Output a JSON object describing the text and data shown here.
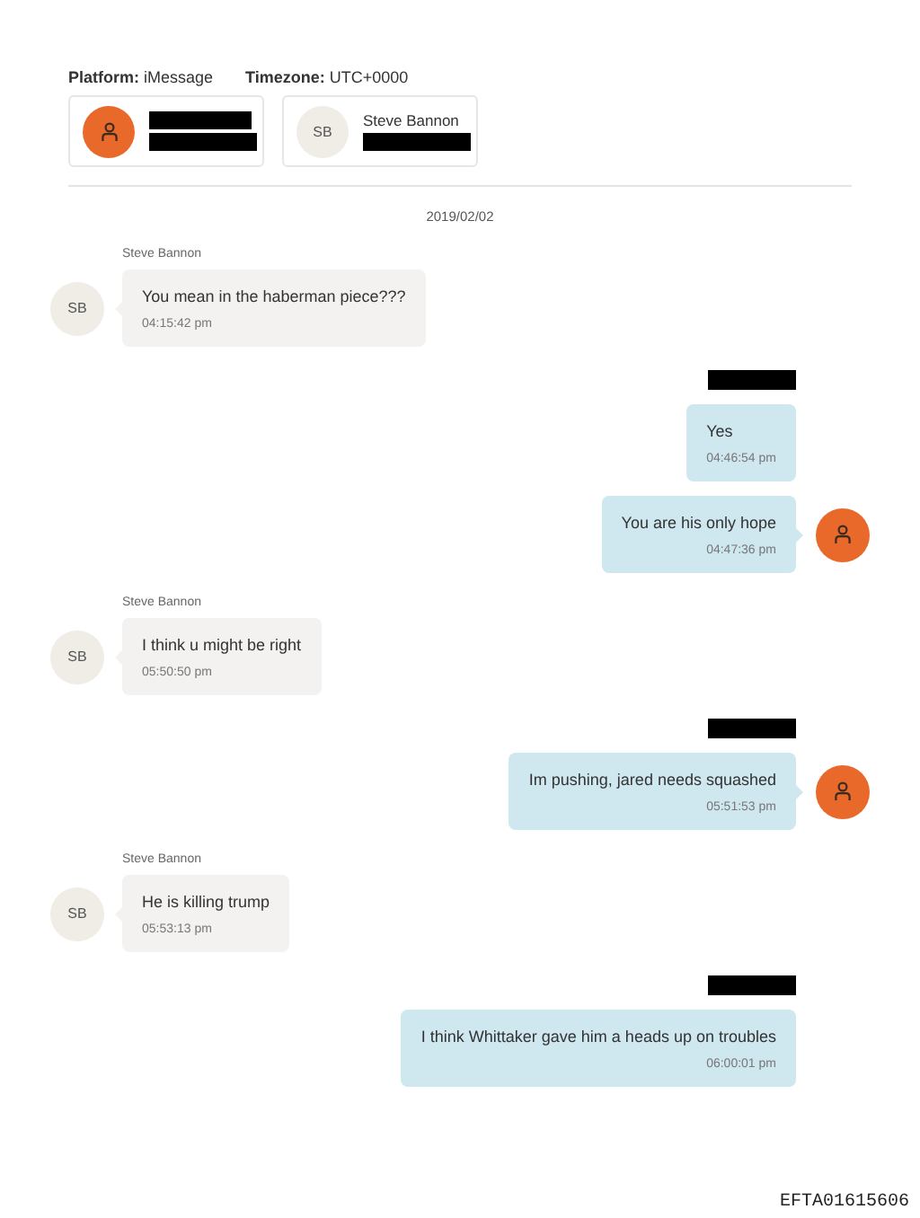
{
  "header": {
    "platform_label": "Platform:",
    "platform": "iMessage",
    "timezone_label": "Timezone:",
    "timezone": "UTC+0000"
  },
  "participants": [
    {
      "avatar": {
        "kind": "icon"
      },
      "name_redacted": true,
      "detail_redacted": true
    },
    {
      "avatar": {
        "kind": "initials",
        "initials": "SB"
      },
      "name": "Steve Bannon",
      "detail_redacted": true
    }
  ],
  "date": "2019/02/02",
  "groups": [
    {
      "kind": "in",
      "sender": "Steve Bannon",
      "messages": [
        {
          "text": "You mean in the haberman piece???",
          "time": "04:15:42 pm",
          "avatar": {
            "kind": "initials",
            "initials": "SB"
          }
        }
      ]
    },
    {
      "kind": "out",
      "sender_redacted": true,
      "messages": [
        {
          "text": "Yes",
          "time": "04:46:54 pm"
        },
        {
          "text": "You are his only hope",
          "time": "04:47:36 pm",
          "avatar": {
            "kind": "icon"
          }
        }
      ]
    },
    {
      "kind": "in",
      "sender": "Steve Bannon",
      "messages": [
        {
          "text": "I think u might be right",
          "time": "05:50:50 pm",
          "avatar": {
            "kind": "initials",
            "initials": "SB"
          }
        }
      ]
    },
    {
      "kind": "out",
      "sender_redacted": true,
      "messages": [
        {
          "text": "Im pushing, jared needs squashed",
          "time": "05:51:53 pm",
          "avatar": {
            "kind": "icon"
          }
        }
      ]
    },
    {
      "kind": "in",
      "sender": "Steve Bannon",
      "messages": [
        {
          "text": "He is killing trump",
          "time": "05:53:13 pm",
          "avatar": {
            "kind": "initials",
            "initials": "SB"
          }
        }
      ]
    },
    {
      "kind": "out",
      "sender_redacted": true,
      "messages": [
        {
          "text": "I think Whittaker gave him a heads up on troubles",
          "time": "06:00:01 pm"
        }
      ]
    }
  ],
  "footer": {
    "document_id": "EFTA01615606"
  }
}
